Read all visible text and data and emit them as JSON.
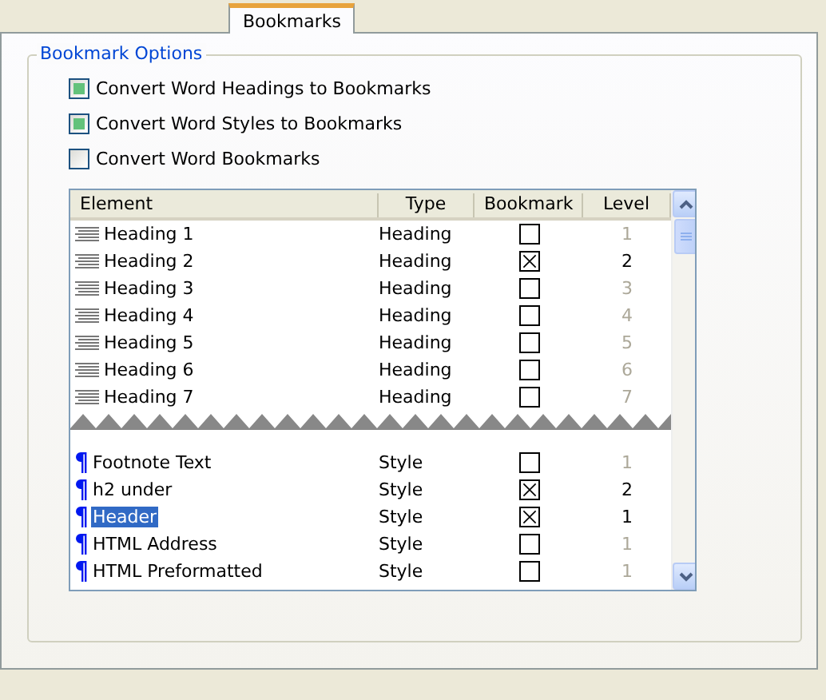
{
  "tabs": [
    {
      "label": "Bookmarks",
      "selected": true
    }
  ],
  "group": {
    "title": "Bookmark Options"
  },
  "options": [
    {
      "label": "Convert Word Headings to Bookmarks",
      "checked": true
    },
    {
      "label": "Convert Word Styles to Bookmarks",
      "checked": true
    },
    {
      "label": "Convert Word Bookmarks",
      "checked": false
    }
  ],
  "table": {
    "columns": [
      "Element",
      "Type",
      "Bookmark",
      "Level"
    ],
    "sections": [
      {
        "rows": [
          {
            "kind": "heading",
            "element": "Heading 1",
            "type": "Heading",
            "bookmark": false,
            "level": "1",
            "selected": false
          },
          {
            "kind": "heading",
            "element": "Heading 2",
            "type": "Heading",
            "bookmark": true,
            "level": "2",
            "selected": false
          },
          {
            "kind": "heading",
            "element": "Heading 3",
            "type": "Heading",
            "bookmark": false,
            "level": "3",
            "selected": false
          },
          {
            "kind": "heading",
            "element": "Heading 4",
            "type": "Heading",
            "bookmark": false,
            "level": "4",
            "selected": false
          },
          {
            "kind": "heading",
            "element": "Heading 5",
            "type": "Heading",
            "bookmark": false,
            "level": "5",
            "selected": false
          },
          {
            "kind": "heading",
            "element": "Heading 6",
            "type": "Heading",
            "bookmark": false,
            "level": "6",
            "selected": false
          },
          {
            "kind": "heading",
            "element": "Heading 7",
            "type": "Heading",
            "bookmark": false,
            "level": "7",
            "selected": false
          }
        ]
      },
      {
        "rows": [
          {
            "kind": "style",
            "element": "Footnote Text",
            "type": "Style",
            "bookmark": false,
            "level": "1",
            "selected": false
          },
          {
            "kind": "style",
            "element": "h2 under",
            "type": "Style",
            "bookmark": true,
            "level": "2",
            "selected": false
          },
          {
            "kind": "style",
            "element": "Header",
            "type": "Style",
            "bookmark": true,
            "level": "1",
            "selected": true
          },
          {
            "kind": "style",
            "element": "HTML Address",
            "type": "Style",
            "bookmark": false,
            "level": "1",
            "selected": false
          },
          {
            "kind": "style",
            "element": "HTML Preformatted",
            "type": "Style",
            "bookmark": false,
            "level": "1",
            "selected": false
          }
        ]
      }
    ]
  }
}
